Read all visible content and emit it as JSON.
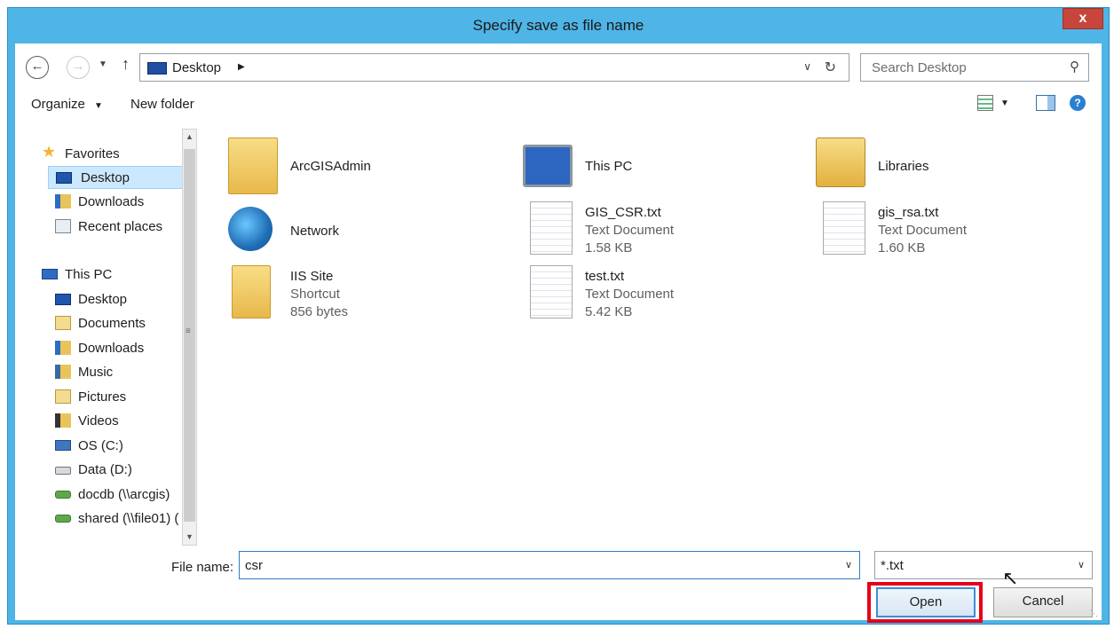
{
  "window": {
    "title": "Specify save as file name",
    "close_label": "x"
  },
  "address_bar": {
    "path": "Desktop",
    "search_placeholder": "Search Desktop"
  },
  "toolbar": {
    "organize": "Organize",
    "new_folder": "New folder"
  },
  "nav_pane": {
    "favorites": "Favorites",
    "favorite_items": [
      "Desktop",
      "Downloads",
      "Recent places"
    ],
    "this_pc": "This PC",
    "pc_items": [
      "Desktop",
      "Documents",
      "Downloads",
      "Music",
      "Pictures",
      "Videos",
      "OS (C:)",
      "Data (D:)",
      "docdb (\\\\arcgis)",
      "shared (\\\\file01) ("
    ]
  },
  "content_items": [
    {
      "name": "ArcGISAdmin",
      "icon": "user-folder-icon"
    },
    {
      "name": "This PC",
      "icon": "computer-icon"
    },
    {
      "name": "Libraries",
      "icon": "libraries-icon"
    },
    {
      "name": "Network",
      "icon": "network-icon"
    },
    {
      "name": "GIS_CSR.txt",
      "type": "Text Document",
      "size": "1.58 KB",
      "icon": "text-file-icon"
    },
    {
      "name": "gis_rsa.txt",
      "type": "Text Document",
      "size": "1.60 KB",
      "icon": "text-file-icon"
    },
    {
      "name": "IIS Site",
      "type": "Shortcut",
      "size": "856 bytes",
      "icon": "shortcut-folder-icon"
    },
    {
      "name": "test.txt",
      "type": "Text Document",
      "size": "5.42 KB",
      "icon": "text-file-icon"
    }
  ],
  "footer": {
    "file_name_label": "File name:",
    "file_name_value": "csr",
    "file_type_value": "*.txt",
    "open_label": "Open",
    "cancel_label": "Cancel"
  },
  "colors": {
    "title_bar": "#4fb4e6",
    "close": "#c7453a",
    "highlight": "#e6001b"
  }
}
